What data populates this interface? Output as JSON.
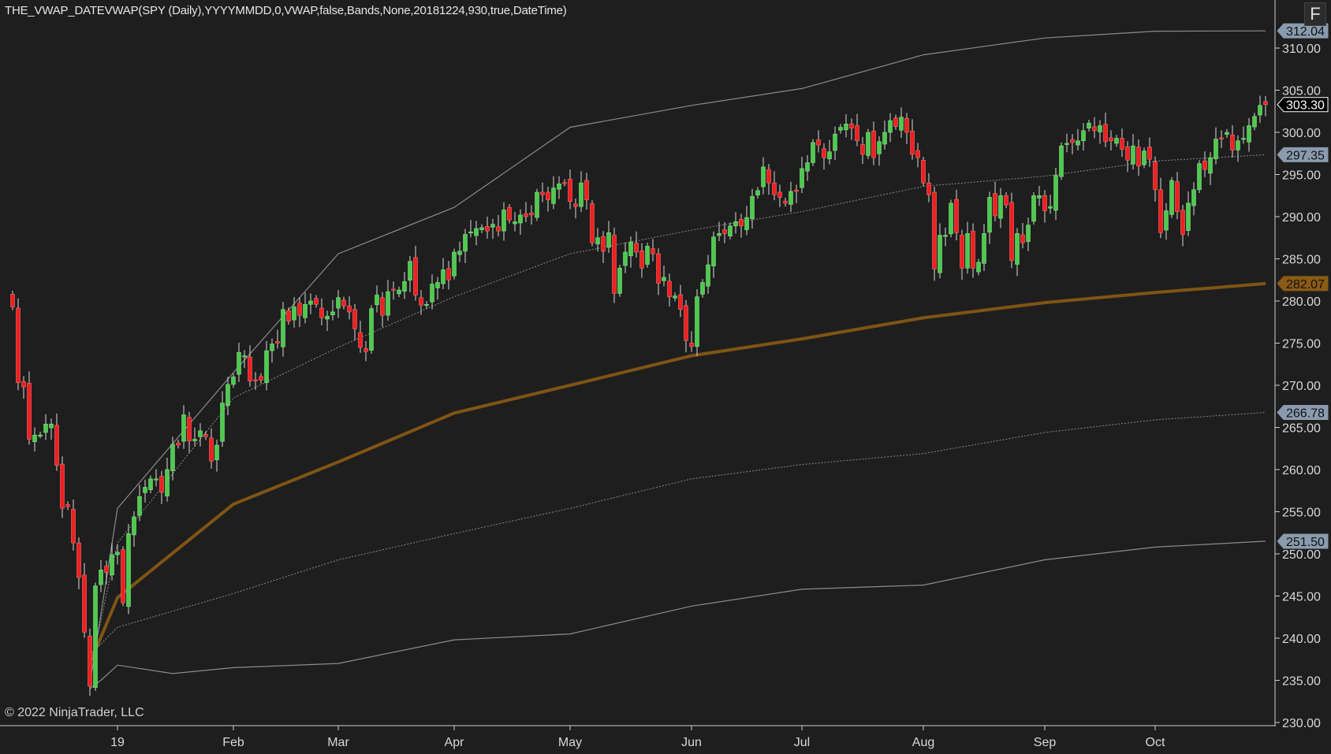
{
  "title": "THE_VWAP_DATEVWAP(SPY (Daily),YYYYMMDD,0,VWAP,false,Bands,None,20181224,930,true,DateTime)",
  "copyright": "© 2022 NinjaTrader, LLC",
  "f_button": "F",
  "colors": {
    "background": "#1e1e1e",
    "up": "#4fc94f",
    "down": "#ee2020",
    "wick": "#d8d8d8",
    "vwap": "#8b5a14",
    "band": "#8c8c8c",
    "tag_band": "#8a9bae",
    "tag_price": "#000000"
  },
  "chart_data": {
    "type": "candlestick",
    "symbol": "SPY (Daily)",
    "ylim": [
      230,
      313
    ],
    "y_ticks": [
      "230.00",
      "235.00",
      "240.00",
      "245.00",
      "250.00",
      "255.00",
      "260.00",
      "265.00",
      "270.00",
      "275.00",
      "280.00",
      "285.00",
      "290.00",
      "295.00",
      "300.00",
      "305.00",
      "310.00"
    ],
    "x_ticks": [
      {
        "label": "19",
        "month": "2019-01"
      },
      {
        "label": "Feb",
        "month": "2019-02"
      },
      {
        "label": "Mar",
        "month": "2019-03"
      },
      {
        "label": "Apr",
        "month": "2019-04"
      },
      {
        "label": "May",
        "month": "2019-05"
      },
      {
        "label": "Jun",
        "month": "2019-06"
      },
      {
        "label": "Jul",
        "month": "2019-07"
      },
      {
        "label": "Aug",
        "month": "2019-08"
      },
      {
        "label": "Sep",
        "month": "2019-09"
      },
      {
        "label": "Oct",
        "month": "2019-10"
      }
    ],
    "months": [
      {
        "month": "2018-12",
        "closes": [
          279.3,
          270.3,
          269.8,
          263.6,
          264.1,
          264.1,
          265.4,
          265.4,
          260.5,
          255.4,
          255.6,
          251.3,
          247.2,
          240.7,
          234.3,
          246.2,
          248.1,
          247.8,
          249.9
        ]
      },
      {
        "month": "2019-01",
        "closes": [
          250.2,
          244.2,
          252.4,
          254.4,
          256.8,
          257.9,
          258.9,
          258.9,
          257.3,
          260.0,
          263.0,
          262.9,
          266.5,
          263.4,
          263.6,
          264.6,
          263.9,
          261.0,
          262.9,
          267.9,
          270.1
        ]
      },
      {
        "month": "2019-02",
        "closes": [
          271.0,
          273.9,
          273.5,
          270.5,
          270.6,
          270.6,
          274.1,
          274.9,
          275.0,
          279.0,
          277.6,
          279.3,
          278.3,
          279.6,
          280.0,
          279.6,
          278.0,
          278.2,
          278.7
        ]
      },
      {
        "month": "2019-03",
        "closes": [
          280.4,
          279.4,
          278.7,
          276.7,
          274.5,
          274.0,
          279.1,
          280.7,
          278.3,
          281.1,
          281.3,
          281.3,
          282.3,
          284.7,
          280.7,
          279.5,
          279.6,
          282.0,
          282.2,
          283.7,
          282.5
        ]
      },
      {
        "month": "2019-04",
        "closes": [
          285.8,
          285.9,
          287.9,
          288.2,
          288.6,
          288.7,
          288.3,
          289.1,
          288.3,
          290.8,
          289.6,
          289.4,
          290.2,
          290.0,
          290.2,
          292.9,
          292.6,
          292.0,
          293.4,
          293.9,
          294.0
        ]
      },
      {
        "month": "2019-05",
        "closes": [
          291.8,
          291.2,
          294.0,
          292.0,
          286.9,
          287.5,
          285.9,
          288.1,
          280.9,
          283.9,
          285.8,
          287.0,
          285.8,
          283.9,
          286.5,
          285.6,
          282.1,
          282.8,
          280.5,
          280.6,
          279.0,
          275.3
        ]
      },
      {
        "month": "2019-06",
        "closes": [
          274.6,
          280.5,
          282.2,
          284.3,
          287.6,
          288.0,
          288.0,
          288.9,
          289.4,
          288.9,
          289.9,
          292.4,
          293.1,
          295.9,
          294.0,
          292.6,
          292.3,
          291.6,
          293.0,
          293.0
        ]
      },
      {
        "month": "2019-07",
        "closes": [
          295.7,
          296.4,
          298.8,
          298.5,
          297.0,
          297.7,
          299.8,
          300.6,
          301.0,
          300.5,
          299.0,
          297.4,
          300.0,
          297.0,
          298.9,
          300.0,
          301.4,
          300.7,
          301.8,
          300.0,
          297.4,
          297.0
        ]
      },
      {
        "month": "2019-08",
        "closes": [
          294.0,
          292.6,
          283.8,
          287.8,
          287.8,
          291.6,
          288.1,
          283.9,
          288.0,
          283.9,
          284.6,
          288.0,
          292.3,
          290.1,
          292.5,
          291.4,
          284.8,
          288.0,
          286.9,
          289.0,
          292.5,
          292.5
        ]
      },
      {
        "month": "2019-09",
        "closes": [
          290.7,
          291.2,
          294.9,
          298.4,
          298.7,
          298.8,
          299.0,
          300.2,
          301.1,
          300.2,
          300.8,
          298.9,
          299.0,
          299.3,
          298.0,
          296.7,
          298.4,
          296.0,
          297.8,
          296.8
        ]
      },
      {
        "month": "2019-10",
        "closes": [
          293.2,
          288.1,
          290.7,
          294.3,
          290.6,
          287.9,
          291.6,
          293.2,
          296.3,
          295.6,
          297.0,
          299.2,
          299.3,
          300.0,
          297.9,
          299.0,
          299.3,
          300.8,
          301.9,
          303.2,
          303.3
        ]
      }
    ],
    "vwap_anchor": "20181224",
    "lines": [
      {
        "name": "VWAP",
        "style": "thick",
        "last": "282.07",
        "points": [
          [
            "2018-12",
            14,
            237.0
          ],
          [
            "2019-01",
            0,
            244.8
          ],
          [
            "2019-02",
            0,
            255.9
          ],
          [
            "2019-03",
            0,
            260.9
          ],
          [
            "2019-04",
            0,
            266.7
          ],
          [
            "2019-05",
            0,
            270.0
          ],
          [
            "2019-06",
            0,
            273.5
          ],
          [
            "2019-07",
            0,
            275.5
          ],
          [
            "2019-08",
            0,
            278.0
          ],
          [
            "2019-09",
            0,
            279.8
          ],
          [
            "2019-10",
            0,
            281.0
          ],
          [
            "2019-10",
            20,
            282.07
          ]
        ]
      },
      {
        "name": "Upper 1",
        "style": "dotted",
        "last": "297.35",
        "points": [
          [
            "2018-12",
            14,
            236.0
          ],
          [
            "2019-01",
            0,
            251.3
          ],
          [
            "2019-02",
            0,
            268.5
          ],
          [
            "2019-03",
            0,
            274.5
          ],
          [
            "2019-04",
            0,
            280.5
          ],
          [
            "2019-05",
            0,
            285.6
          ],
          [
            "2019-06",
            0,
            288.4
          ],
          [
            "2019-07",
            0,
            290.6
          ],
          [
            "2019-08",
            0,
            293.6
          ],
          [
            "2019-09",
            0,
            294.8
          ],
          [
            "2019-10",
            0,
            296.6
          ],
          [
            "2019-10",
            20,
            297.35
          ]
        ]
      },
      {
        "name": "Upper 2",
        "style": "solid",
        "last": "312.04",
        "points": [
          [
            "2018-12",
            14,
            234.5
          ],
          [
            "2019-01",
            0,
            255.4
          ],
          [
            "2019-02",
            0,
            271.5
          ],
          [
            "2019-03",
            0,
            285.6
          ],
          [
            "2019-04",
            0,
            291.1
          ],
          [
            "2019-05",
            0,
            300.6
          ],
          [
            "2019-06",
            0,
            303.2
          ],
          [
            "2019-07",
            0,
            305.2
          ],
          [
            "2019-08",
            0,
            309.2
          ],
          [
            "2019-09",
            0,
            311.2
          ],
          [
            "2019-10",
            0,
            312.0
          ],
          [
            "2019-10",
            20,
            312.04
          ]
        ]
      },
      {
        "name": "Lower 1",
        "style": "dotted",
        "last": "266.78",
        "points": [
          [
            "2018-12",
            14,
            238.0
          ],
          [
            "2019-01",
            0,
            241.3
          ],
          [
            "2019-02",
            0,
            245.3
          ],
          [
            "2019-03",
            0,
            249.3
          ],
          [
            "2019-04",
            0,
            252.4
          ],
          [
            "2019-05",
            0,
            255.4
          ],
          [
            "2019-06",
            0,
            258.9
          ],
          [
            "2019-07",
            0,
            260.6
          ],
          [
            "2019-08",
            0,
            261.9
          ],
          [
            "2019-09",
            0,
            264.4
          ],
          [
            "2019-10",
            0,
            265.9
          ],
          [
            "2019-10",
            20,
            266.78
          ]
        ]
      },
      {
        "name": "Lower 2",
        "style": "solid",
        "last": "251.50",
        "points": [
          [
            "2018-12",
            14,
            234.0
          ],
          [
            "2018-12",
            16,
            235.0
          ],
          [
            "2019-01",
            0,
            236.8
          ],
          [
            "2019-01",
            10,
            235.8
          ],
          [
            "2019-02",
            0,
            236.5
          ],
          [
            "2019-03",
            0,
            237.0
          ],
          [
            "2019-04",
            0,
            239.8
          ],
          [
            "2019-05",
            0,
            240.5
          ],
          [
            "2019-06",
            0,
            243.8
          ],
          [
            "2019-07",
            0,
            245.8
          ],
          [
            "2019-08",
            0,
            246.3
          ],
          [
            "2019-09",
            0,
            249.3
          ],
          [
            "2019-10",
            0,
            250.8
          ],
          [
            "2019-10",
            20,
            251.5
          ]
        ]
      }
    ],
    "last_price": "303.30"
  }
}
